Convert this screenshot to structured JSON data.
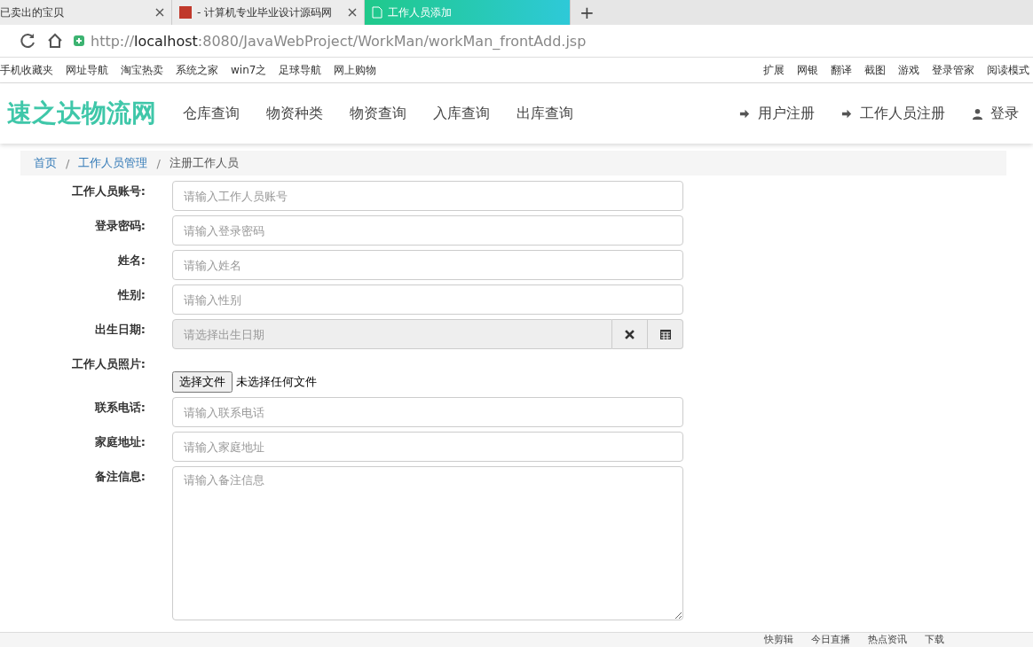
{
  "browser": {
    "tabs": [
      {
        "title": "已卖出的宝贝",
        "selected": false,
        "kind": "plain"
      },
      {
        "title": "- 计算机专业毕业设计源码网",
        "selected": false,
        "kind": "site"
      },
      {
        "title": "工作人员添加",
        "selected": true,
        "kind": "page"
      }
    ],
    "new_tab": "+",
    "url": "http://**localhost**:8080/JavaWebProject/WorkMan/workMan_frontAdd.jsp",
    "bookmarks": [
      "手机收藏夹",
      "网址导航",
      "淘宝热卖",
      "系统之家",
      "win7之",
      "足球导航",
      "网上购物"
    ],
    "tools": [
      "扩展",
      "网银",
      "翻译",
      "截图",
      "游戏",
      "登录管家",
      "阅读模式"
    ]
  },
  "site": {
    "brand": "速之达物流网",
    "nav": [
      "仓库查询",
      "物资种类",
      "物资查询",
      "入库查询",
      "出库查询"
    ],
    "account_links": [
      {
        "label": "用户注册",
        "kind": "signin"
      },
      {
        "label": "工作人员注册",
        "kind": "signin"
      },
      {
        "label": "登录",
        "kind": "user"
      }
    ]
  },
  "breadcrumb": [
    "首页",
    "工作人员管理",
    "注册工作人员"
  ],
  "breadcrumb_separators": [
    "/",
    "/"
  ],
  "form": [
    {
      "label": "工作人员账号:",
      "kind": "text",
      "placeholder": "请输入工作人员账号"
    },
    {
      "label": "登录密码:",
      "kind": "text",
      "placeholder": "请输入登录密码"
    },
    {
      "label": "姓名:",
      "kind": "text",
      "placeholder": "请输入姓名"
    },
    {
      "label": "性别:",
      "kind": "text",
      "placeholder": "请输入性别"
    },
    {
      "label": "出生日期:",
      "kind": "date",
      "placeholder": "请选择出生日期"
    },
    {
      "label": "工作人员照片:",
      "kind": "file",
      "button": "选择文件",
      "status": "未选择任何文件"
    },
    {
      "label": "联系电话:",
      "kind": "text",
      "placeholder": "请输入联系电话"
    },
    {
      "label": "家庭地址:",
      "kind": "text",
      "placeholder": "请输入家庭地址"
    },
    {
      "label": "备注信息:",
      "kind": "textarea",
      "placeholder": "请输入备注信息"
    }
  ],
  "status_bar": [
    "快剪辑",
    "今日直播",
    "热点资讯",
    "下载"
  ]
}
